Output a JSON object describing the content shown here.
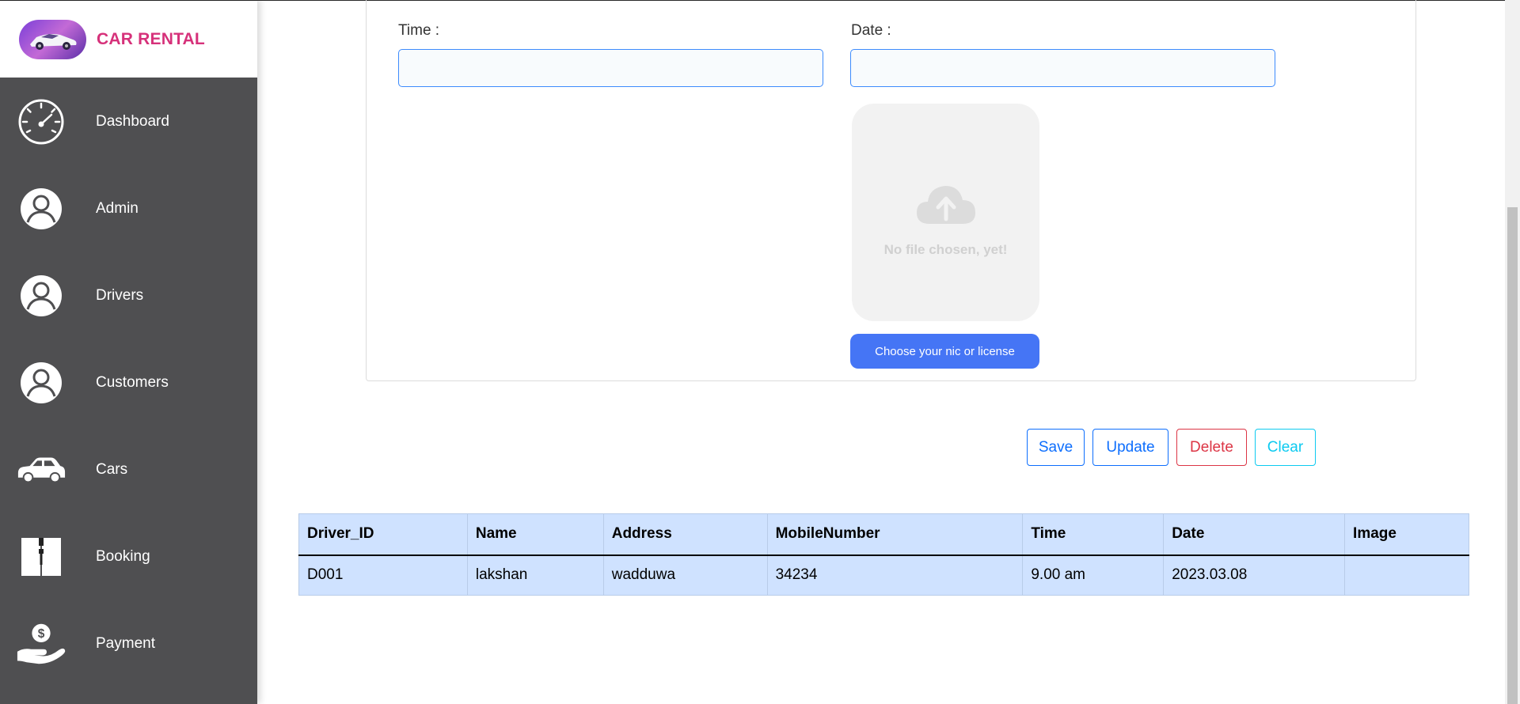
{
  "brand": {
    "name": "CAR RENTAL"
  },
  "sidebar": {
    "items": [
      {
        "label": "Dashboard",
        "icon": "speedometer-icon"
      },
      {
        "label": "Admin",
        "icon": "user-icon"
      },
      {
        "label": "Drivers",
        "icon": "user-icon"
      },
      {
        "label": "Customers",
        "icon": "user-icon"
      },
      {
        "label": "Cars",
        "icon": "car-icon"
      },
      {
        "label": "Booking",
        "icon": "book-icon"
      },
      {
        "label": "Payment",
        "icon": "payment-hand-icon"
      }
    ]
  },
  "form": {
    "time_label": "Time :",
    "time_value": "",
    "date_label": "Date :",
    "date_value": "",
    "upload_placeholder": "No file chosen, yet!",
    "choose_button": "Choose your nic or license"
  },
  "actions": {
    "save": "Save",
    "update": "Update",
    "delete": "Delete",
    "clear": "Clear"
  },
  "table": {
    "headers": [
      "Driver_ID",
      "Name",
      "Address",
      "MobileNumber",
      "Time",
      "Date",
      "Image"
    ],
    "rows": [
      [
        "D001",
        "lakshan",
        "wadduwa",
        "34234",
        "9.00 am",
        "2023.03.08",
        ""
      ]
    ]
  },
  "colors": {
    "sidebar_bg": "#4f4f51",
    "brand_text": "#d6317a",
    "primary": "#0d6efd",
    "danger": "#dc3545",
    "info": "#0dcaf0",
    "table_bg": "#cfe2ff",
    "choose_button_bg": "#4575f5"
  }
}
